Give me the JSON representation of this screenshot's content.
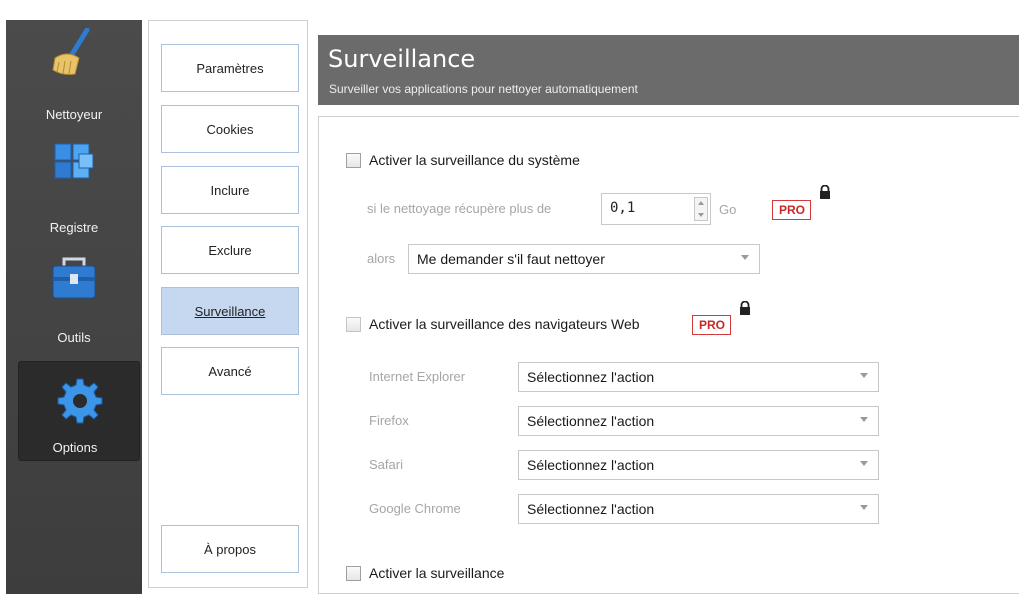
{
  "app_nav": [
    {
      "label": "Nettoyeur",
      "icon": "broom-icon"
    },
    {
      "label": "Registre",
      "icon": "registry-cubes-icon"
    },
    {
      "label": "Outils",
      "icon": "toolbox-icon"
    },
    {
      "label": "Options",
      "icon": "gear-icon",
      "active": true
    }
  ],
  "sub_nav": {
    "items": [
      "Paramètres",
      "Cookies",
      "Inclure",
      "Exclure",
      "Surveillance",
      "Avancé"
    ],
    "active": "Surveillance",
    "about": "À propos"
  },
  "header": {
    "title": "Surveillance",
    "subtitle": "Surveiller vos applications pour nettoyer automatiquement"
  },
  "system_monitoring": {
    "label": "Activer la surveillance du système",
    "checked": false,
    "threshold_prefix": "si le nettoyage récupère plus de",
    "threshold_value": "0,1",
    "threshold_unit": "Go",
    "then_label": "alors",
    "then_value": "Me demander s'il faut nettoyer",
    "pro_badge": "PRO"
  },
  "browser_monitoring": {
    "label": "Activer la surveillance des navigateurs Web",
    "checked": false,
    "pro_badge": "PRO",
    "browsers": [
      {
        "name": "Internet Explorer",
        "action": "Sélectionnez l'action"
      },
      {
        "name": "Firefox",
        "action": "Sélectionnez l'action"
      },
      {
        "name": "Safari",
        "action": "Sélectionnez l'action"
      },
      {
        "name": "Google Chrome",
        "action": "Sélectionnez l'action"
      }
    ]
  },
  "bottom_checkbox": {
    "label": "Activer la surveillance",
    "checked": false
  },
  "colors": {
    "sidebar": "#444444",
    "header": "#6b6b6b",
    "active_tab": "#c5d8ef",
    "pro": "#d43a3a"
  }
}
